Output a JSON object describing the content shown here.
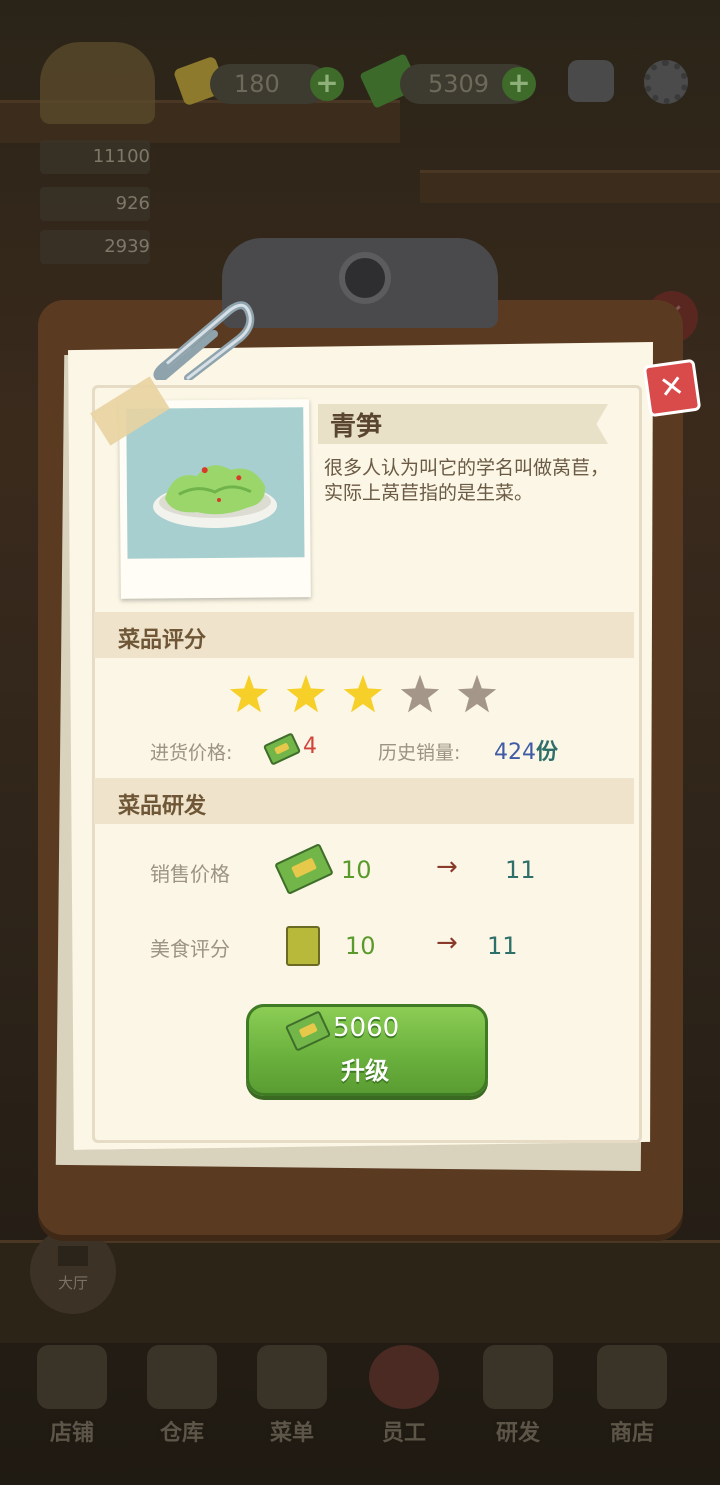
{
  "top_bar": {
    "gems": "180",
    "cash": "5309"
  },
  "side_stats": [
    "11100",
    "926",
    "2939"
  ],
  "hall_label": "大厅",
  "bottom_nav": [
    "店铺",
    "仓库",
    "菜单",
    "员工",
    "研发",
    "商店"
  ],
  "dish": {
    "name": "青笋",
    "description": "很多人认为叫它的学名叫做莴苣，实际上莴苣指的是生菜。"
  },
  "rating": {
    "section_title": "菜品评分",
    "stars_filled": 3,
    "stars_total": 5,
    "purchase_price_label": "进货价格:",
    "purchase_price": "4",
    "sales_label": "历史销量:",
    "sales_value": "424",
    "sales_unit": "份"
  },
  "research": {
    "section_title": "菜品研发",
    "price_label": "销售价格",
    "price_from": "10",
    "price_to": "11",
    "food_label": "美食评分",
    "food_from": "10",
    "food_to": "11",
    "arrow": "→"
  },
  "upgrade": {
    "cost": "5060",
    "label": "升级"
  },
  "colors": {
    "accent_green": "#6bb23e",
    "close_red": "#d94a4a",
    "sales_blue": "#3f5aa6",
    "price_red": "#d2443a"
  }
}
